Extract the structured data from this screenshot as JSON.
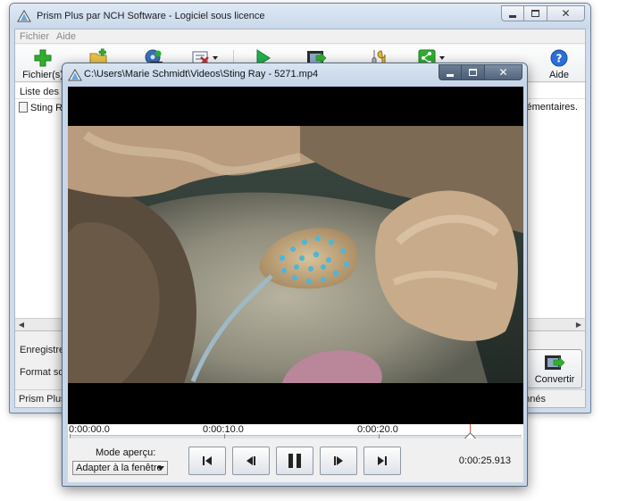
{
  "main_window": {
    "title": "Prism Plus par NCH Software - Logiciel sous licence",
    "menu": [
      "Fichier",
      "Aide"
    ],
    "toolbar": {
      "add_files_label": "Fichier(s)",
      "help_label": "Aide"
    },
    "file_list": {
      "header": "Liste des fic",
      "row_name": "Sting Ra",
      "right_note": "plémentaires."
    },
    "settings": {
      "save_label": "Enregistrer d",
      "format_label": "Format sorti"
    },
    "convert_label": "Convertir",
    "status_left": "Prism Plus v",
    "status_right": "nnés"
  },
  "preview_window": {
    "title": "C:\\Users\\Marie Schmidt\\Videos\\Sting Ray - 5271.mp4",
    "timeline": {
      "labels": [
        "0:00:00.0",
        "0:00:10.0",
        "0:00:20.0"
      ],
      "playhead_seconds": 25.9,
      "total_seconds": 29.5
    },
    "mode_label": "Mode aperçu:",
    "mode_value": "Adapter à la fenêtre",
    "current_time": "0:00:25.913"
  },
  "colors": {
    "accent_green": "#2fae2f",
    "play_green": "#22b14c",
    "help_blue": "#2a6fd6",
    "playhead": "#d85a3a"
  }
}
